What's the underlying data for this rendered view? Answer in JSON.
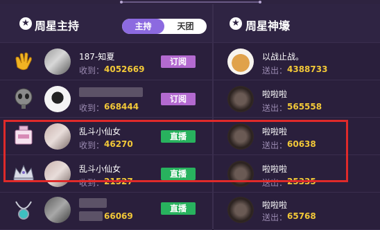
{
  "left": {
    "title": "周星主持",
    "tabs": {
      "active": "主持",
      "inactive": "天团"
    },
    "rows": [
      {
        "name": "187-知夏",
        "stat_label": "收到：",
        "stat_value": "4052669",
        "button": "订阅",
        "button_type": "subscribe",
        "gift_icon": "clapping-hands-icon",
        "avatar_color": "#7f7f7f"
      },
      {
        "name": "",
        "stat_label": "收到：",
        "stat_value": "668444",
        "button": "订阅",
        "button_type": "subscribe",
        "gift_icon": "alien-icon",
        "avatar_color": "#e9e9e9"
      },
      {
        "name": "乱斗小仙女",
        "stat_label": "收到：",
        "stat_value": "46270",
        "button": "直播",
        "button_type": "live",
        "gift_icon": "perfume-icon",
        "avatar_color": "#cbb8b4"
      },
      {
        "name": "乱斗小仙女",
        "stat_label": "收到：",
        "stat_value": "21527",
        "button": "直播",
        "button_type": "live",
        "gift_icon": "crown-icon",
        "avatar_color": "#cbb8b4"
      },
      {
        "name": "",
        "stat_label": "",
        "stat_value": "66069",
        "button": "直播",
        "button_type": "live",
        "gift_icon": "necklace-icon",
        "avatar_color": "#7a7a7a"
      }
    ]
  },
  "right": {
    "title": "周星神壕",
    "rows": [
      {
        "name": "以战止战。",
        "stat_label": "送出：",
        "stat_value": "4388733",
        "avatar_color": "#e0a24b"
      },
      {
        "name": "啦啦啦",
        "stat_label": "送出：",
        "stat_value": "565558",
        "avatar_color": "#4a3a36"
      },
      {
        "name": "啦啦啦",
        "stat_label": "送出：",
        "stat_value": "60638",
        "avatar_color": "#4a3a36"
      },
      {
        "name": "啦啦啦",
        "stat_label": "送出：",
        "stat_value": "25335",
        "avatar_color": "#4a3a36"
      },
      {
        "name": "啦啦啦",
        "stat_label": "送出：",
        "stat_value": "65768",
        "avatar_color": "#4a3a36"
      }
    ]
  },
  "colors": {
    "accent": "#8c6ae0",
    "subscribe": "#b36ad0",
    "live": "#28b25e",
    "stat": "#f2c838",
    "highlight": "#e02a2a"
  }
}
